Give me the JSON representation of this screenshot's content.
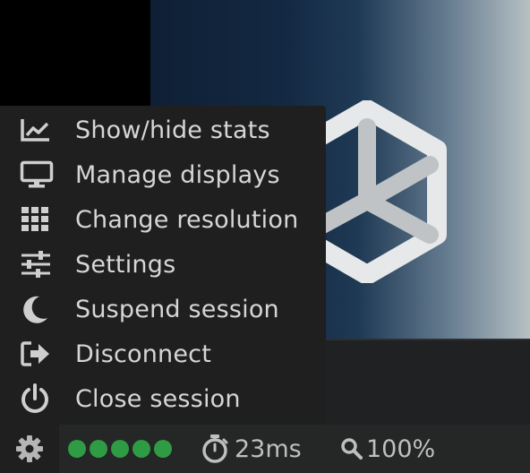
{
  "menu": {
    "items": [
      {
        "label": "Show/hide stats",
        "icon": "line-chart-icon"
      },
      {
        "label": "Manage displays",
        "icon": "monitor-icon"
      },
      {
        "label": "Change resolution",
        "icon": "grid-icon"
      },
      {
        "label": "Settings",
        "icon": "sliders-icon"
      },
      {
        "label": "Suspend session",
        "icon": "moon-icon"
      },
      {
        "label": "Disconnect",
        "icon": "sign-out-icon"
      },
      {
        "label": "Close session",
        "icon": "power-icon"
      }
    ]
  },
  "statusbar": {
    "settings_icon": "gear-icon",
    "quality_level": 5,
    "quality_max": 5,
    "quality_color": "#2f9b45",
    "latency_icon": "stopwatch-icon",
    "latency": "23ms",
    "zoom_icon": "magnifier-icon",
    "zoom": "100%"
  },
  "remote_view": {
    "logo_icon": "hexagon-cube-logo"
  },
  "colors": {
    "menu_bg": "#1f1f1f",
    "statusbar_bg": "#252626",
    "text": "#d6d6d6",
    "icon": "#cfcfcf"
  }
}
